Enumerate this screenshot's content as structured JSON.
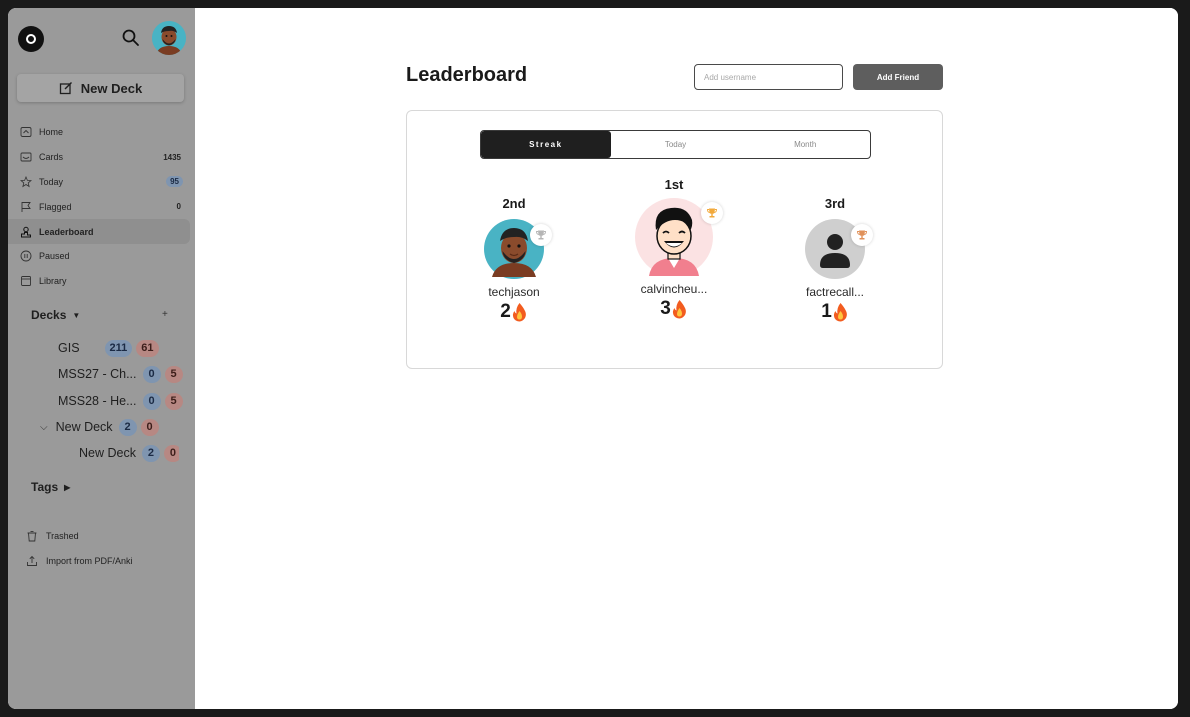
{
  "sidebar": {
    "new_deck_label": "New Deck",
    "nav": [
      {
        "label": "Home",
        "icon": "home-icon",
        "value": ""
      },
      {
        "label": "Cards",
        "icon": "cards-icon",
        "value": "1435"
      },
      {
        "label": "Today",
        "icon": "star-icon",
        "value": "95"
      },
      {
        "label": "Flagged",
        "icon": "flag-icon",
        "value": "0"
      },
      {
        "label": "Leaderboard",
        "icon": "leaderboard-icon",
        "value": ""
      },
      {
        "label": "Paused",
        "icon": "pause-icon",
        "value": ""
      },
      {
        "label": "Library",
        "icon": "library-icon",
        "value": ""
      }
    ],
    "decks_label": "Decks",
    "decks": [
      {
        "name": "GIS",
        "blue": "211",
        "red": "61"
      },
      {
        "name": "MSS27 - Ch...",
        "blue": "0",
        "red": "5"
      },
      {
        "name": "MSS28 - He...",
        "blue": "0",
        "red": "5"
      },
      {
        "name": "New Deck",
        "blue": "2",
        "red": "0"
      },
      {
        "name": "New Deck",
        "blue": "2",
        "red": "0"
      }
    ],
    "tags_label": "Tags",
    "trashed_label": "Trashed",
    "import_label": "Import from PDF/Anki"
  },
  "header": {
    "title": "Leaderboard",
    "input_placeholder": "Add username",
    "add_friend_label": "Add Friend"
  },
  "tabs": [
    "Streak",
    "Today",
    "Month"
  ],
  "podium": [
    {
      "rank": "2nd",
      "username": "techjason",
      "streak": "2"
    },
    {
      "rank": "1st",
      "username": "calvincheu...",
      "streak": "3"
    },
    {
      "rank": "3rd",
      "username": "factrecall...",
      "streak": "1"
    }
  ],
  "colors": {
    "sidebar_bg": "#9a9a9a",
    "active_tab": "#1f1f1f",
    "badge_blue": "#7f95b0",
    "badge_red": "#b78883",
    "gold": "#f2a93b",
    "silver": "#b5b5b5",
    "bronze": "#e0915a"
  }
}
